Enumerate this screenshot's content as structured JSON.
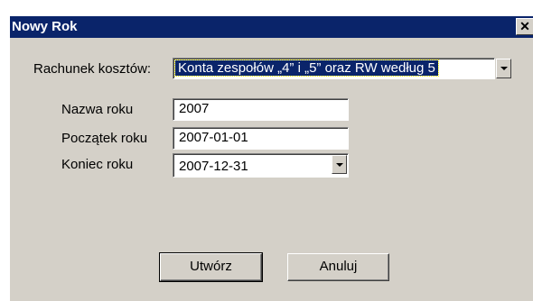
{
  "window": {
    "title": "Nowy Rok",
    "close_glyph": "✕"
  },
  "form": {
    "cost_account_label": "Rachunek kosztów:",
    "cost_account_value": "Konta zespołów „4” i „5” oraz RW według 5",
    "year_name_label": "Nazwa roku",
    "year_name_value": "2007",
    "year_start_label": "Początek roku",
    "year_start_value": "2007-01-01",
    "year_end_label": "Koniec roku",
    "year_end_value": "2007-12-31"
  },
  "buttons": {
    "create_label": "Utwórz",
    "cancel_label": "Anuluj"
  },
  "icons": {
    "dropdown": "chevron-down-icon",
    "close": "close-icon"
  },
  "colors": {
    "titlebar": "#0a246a",
    "face": "#d4d0c8",
    "selection": "#0a246a"
  }
}
